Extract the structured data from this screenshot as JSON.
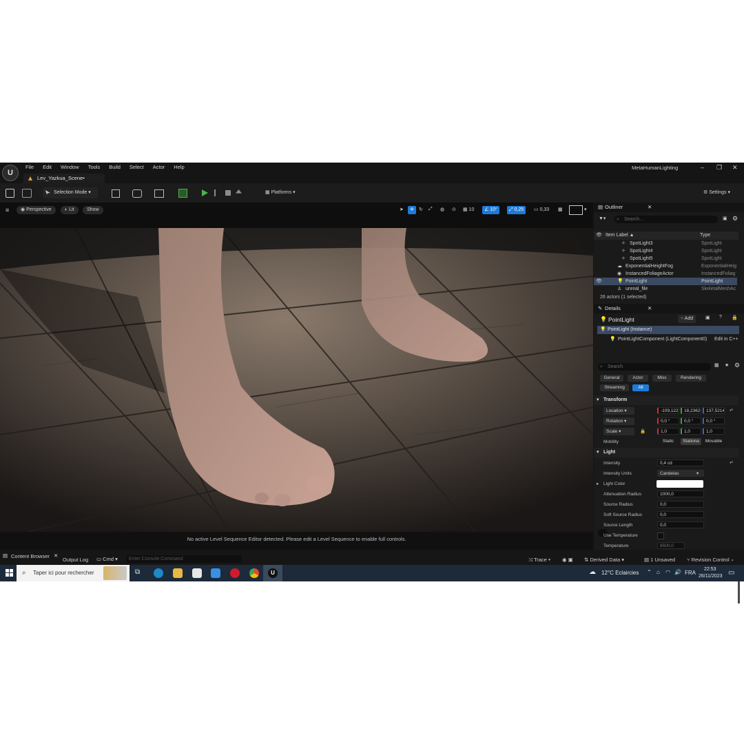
{
  "window": {
    "menu": [
      "File",
      "Edit",
      "Window",
      "Tools",
      "Build",
      "Select",
      "Actor",
      "Help"
    ],
    "project_name": "MetaHumanLighting",
    "tab_title": "Lev_Yazkua_Scene•"
  },
  "toolbar": {
    "selection_mode": "Selection Mode",
    "platforms": "Platforms",
    "settings": "Settings"
  },
  "viewport": {
    "perspective": "Perspective",
    "lit": "Lit",
    "show": "Show",
    "grid_snap": "10",
    "rot_snap": "10°",
    "scale_snap": "0,25",
    "cam_speed": "0,33",
    "message": "No active Level Sequence Editor detected. Please edit a Level Sequence to enable full controls."
  },
  "outliner": {
    "title": "Outliner",
    "search_placeholder": "Search...",
    "col_label": "Item Label ▲",
    "col_type": "Type",
    "rows": [
      {
        "label": "SpotLight3",
        "type": "SpotLight"
      },
      {
        "label": "SpotLight4",
        "type": "SpotLight"
      },
      {
        "label": "SpotLight5",
        "type": "SpotLight"
      },
      {
        "label": "ExponentialHeightFog",
        "type": "ExponentialHeig"
      },
      {
        "label": "InstancedFoliageActor",
        "type": "InstancedFoliag"
      },
      {
        "label": "PointLight",
        "type": "PointLight"
      },
      {
        "label": "unreal_file",
        "type": "SkeletalMeshAc"
      }
    ],
    "footer": "26 actors (1 selected)"
  },
  "details": {
    "title": "Details",
    "actor_name": "PointLight",
    "add_label": "Add",
    "instance": "PointLight (Instance)",
    "component": "PointLightComponent (LightComponent0)",
    "edit_cpp": "Edit in C++",
    "search_placeholder": "Search",
    "categories": [
      "General",
      "Actor",
      "Misc",
      "Rendering",
      "Streaming",
      "All"
    ],
    "transform_title": "Transform",
    "location_label": "Location",
    "location": [
      "-109,122",
      "18,23626",
      "137,5214"
    ],
    "rotation_label": "Rotation",
    "rotation": [
      "0,0 °",
      "0,0 °",
      "0,0 °"
    ],
    "scale_label": "Scale",
    "scale": [
      "1,0",
      "1,0",
      "1,0"
    ],
    "mobility_label": "Mobility",
    "mobility_options": [
      "Static",
      "Stationa",
      "Movable"
    ],
    "light_title": "Light",
    "intensity_label": "Intensity",
    "intensity": "0,4 cd",
    "intensity_units_label": "Intensity Units",
    "intensity_units": "Candelas",
    "light_color_label": "Light Color",
    "attenuation_label": "Attenuation Radius",
    "attenuation": "1000,0",
    "source_radius_label": "Source Radius",
    "source_radius": "0,0",
    "soft_source_label": "Soft Source Radius",
    "soft_source": "0,0",
    "source_length_label": "Source Length",
    "source_length": "0,0",
    "use_temp_label": "Use Temperature",
    "temperature_label": "Temperature",
    "temperature": "6500,0"
  },
  "statusbar": {
    "content_browser": "Content Browser",
    "output_log": "Output Log",
    "cmd": "Cmd",
    "console_placeholder": "Enter Console Command",
    "trace": "Trace",
    "derived_data": "Derived Data",
    "unsaved": "1 Unsaved",
    "revision_control": "Revision Control"
  },
  "taskbar": {
    "search": "Taper ici pour rechercher",
    "weather": "12°C  Eclaircies",
    "lang": "FRA",
    "time": "22:53",
    "date": "26/11/2023"
  },
  "colors": {
    "accent": "#1e7bd9",
    "selection": "#3b4a63",
    "play_green": "#4bb34b",
    "taskbar": "#1c2a3a"
  }
}
